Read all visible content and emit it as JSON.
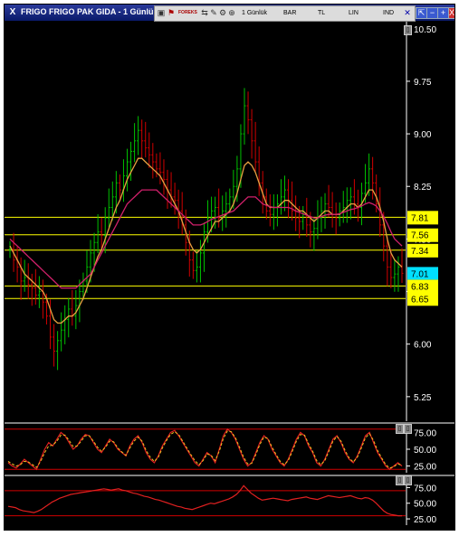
{
  "window": {
    "title": "FRIGO FRIGO PAK GIDA - 1 Günlük (.1d)",
    "close_glyph": "X"
  },
  "toolbar": {
    "forex_label": "FOREKS",
    "period_label": "1 Günlük",
    "chart_type_label": "BAR",
    "currency_label": "TL",
    "scale_label": "LIN",
    "indicator_label": "IND"
  },
  "window_buttons": [
    "⇱",
    "−",
    "+",
    "X"
  ],
  "colors": {
    "background": "#000000",
    "accent": "#ffff00",
    "price_tag": "#00e0ff",
    "ma_fast": "#e8a040",
    "ma_slow": "#d0206a",
    "bull_candle": "#00c000",
    "bear_candle": "#d00000"
  },
  "chart_data": [
    {
      "type": "line",
      "title": "",
      "ylim": [
        4.9,
        10.6
      ],
      "yticks": [
        "10.50",
        "9.75",
        "9.00",
        "8.25",
        "7.50",
        "6.75",
        "6.00",
        "5.25"
      ],
      "yaxis_position": "right",
      "grid": false,
      "last_price": "7.01",
      "levels": [
        {
          "label": "7.81",
          "value": 7.81
        },
        {
          "label": "7.56",
          "value": 7.56
        },
        {
          "label": "7.34",
          "value": 7.34
        },
        {
          "label": "6.83",
          "value": 6.83
        },
        {
          "label": "6.65",
          "value": 6.65
        }
      ],
      "close": [
        7.35,
        7.2,
        7.1,
        6.9,
        6.95,
        6.85,
        6.8,
        6.7,
        6.75,
        6.6,
        6.4,
        6.1,
        5.9,
        6.05,
        6.2,
        6.35,
        6.5,
        6.4,
        6.55,
        6.75,
        6.9,
        7.1,
        7.3,
        7.45,
        7.6,
        7.55,
        7.8,
        7.95,
        8.1,
        8.3,
        8.2,
        8.4,
        8.6,
        8.75,
        8.9,
        9.05,
        8.9,
        8.8,
        8.7,
        8.6,
        8.5,
        8.45,
        8.35,
        8.2,
        8.1,
        8.05,
        7.9,
        7.7,
        7.45,
        7.2,
        7.05,
        7.1,
        7.3,
        7.6,
        7.8,
        7.9,
        7.95,
        7.8,
        7.9,
        8.0,
        8.1,
        8.25,
        8.5,
        9.0,
        9.4,
        9.2,
        8.9,
        8.6,
        8.3,
        8.1,
        7.9,
        7.85,
        7.95,
        8.0,
        8.1,
        8.2,
        8.05,
        7.9,
        7.8,
        7.75,
        7.85,
        7.7,
        7.6,
        7.65,
        7.8,
        7.9,
        8.0,
        7.95,
        7.85,
        7.8,
        7.9,
        7.95,
        8.05,
        8.1,
        8.0,
        7.95,
        8.15,
        8.3,
        8.5,
        8.3,
        8.0,
        7.7,
        7.4,
        7.1,
        6.95,
        7.0,
        7.1,
        7.01
      ],
      "ma_fast": [
        7.4,
        7.3,
        7.2,
        7.1,
        7.0,
        6.95,
        6.9,
        6.85,
        6.8,
        6.75,
        6.65,
        6.5,
        6.35,
        6.3,
        6.3,
        6.35,
        6.4,
        6.4,
        6.45,
        6.55,
        6.65,
        6.8,
        6.95,
        7.1,
        7.25,
        7.35,
        7.5,
        7.65,
        7.8,
        7.95,
        8.05,
        8.2,
        8.35,
        8.45,
        8.55,
        8.65,
        8.65,
        8.6,
        8.55,
        8.5,
        8.45,
        8.4,
        8.3,
        8.2,
        8.1,
        8.0,
        7.9,
        7.75,
        7.6,
        7.45,
        7.35,
        7.3,
        7.35,
        7.45,
        7.55,
        7.65,
        7.75,
        7.75,
        7.8,
        7.85,
        7.9,
        8.0,
        8.15,
        8.35,
        8.55,
        8.6,
        8.55,
        8.45,
        8.3,
        8.15,
        8.0,
        7.95,
        7.95,
        7.95,
        8.0,
        8.05,
        8.05,
        8.0,
        7.95,
        7.9,
        7.9,
        7.85,
        7.8,
        7.75,
        7.8,
        7.85,
        7.9,
        7.9,
        7.85,
        7.85,
        7.85,
        7.9,
        7.95,
        8.0,
        8.0,
        7.95,
        8.0,
        8.1,
        8.2,
        8.2,
        8.1,
        7.95,
        7.75,
        7.5,
        7.3,
        7.2,
        7.15,
        7.1
      ],
      "ma_slow": [
        7.5,
        7.45,
        7.4,
        7.35,
        7.3,
        7.25,
        7.2,
        7.15,
        7.1,
        7.05,
        7.0,
        6.95,
        6.9,
        6.85,
        6.8,
        6.8,
        6.8,
        6.8,
        6.8,
        6.85,
        6.9,
        6.95,
        7.0,
        7.1,
        7.2,
        7.3,
        7.4,
        7.5,
        7.6,
        7.7,
        7.8,
        7.9,
        8.0,
        8.05,
        8.1,
        8.15,
        8.2,
        8.2,
        8.2,
        8.2,
        8.2,
        8.15,
        8.1,
        8.05,
        8.0,
        7.95,
        7.9,
        7.85,
        7.8,
        7.75,
        7.7,
        7.7,
        7.7,
        7.72,
        7.75,
        7.78,
        7.8,
        7.82,
        7.84,
        7.86,
        7.88,
        7.9,
        7.95,
        8.0,
        8.05,
        8.1,
        8.1,
        8.1,
        8.05,
        8.0,
        7.98,
        7.96,
        7.95,
        7.95,
        7.95,
        7.95,
        7.95,
        7.93,
        7.9,
        7.88,
        7.86,
        7.84,
        7.82,
        7.8,
        7.8,
        7.82,
        7.84,
        7.85,
        7.85,
        7.85,
        7.86,
        7.88,
        7.9,
        7.92,
        7.93,
        7.95,
        7.97,
        8.0,
        8.02,
        8.0,
        7.97,
        7.9,
        7.82,
        7.72,
        7.6,
        7.5,
        7.45,
        7.4
      ]
    },
    {
      "type": "line",
      "title": "",
      "ylim": [
        15,
        85
      ],
      "yticks": [
        "75.00",
        "50.00",
        "25.00"
      ],
      "extra_ticks": [
        "75.00",
        "50.00",
        "25.00"
      ],
      "bands": [
        80,
        20
      ],
      "values": [
        30,
        25,
        22,
        28,
        35,
        30,
        25,
        20,
        35,
        50,
        60,
        55,
        65,
        75,
        70,
        60,
        50,
        55,
        65,
        72,
        70,
        60,
        50,
        45,
        55,
        65,
        60,
        50,
        45,
        40,
        55,
        65,
        70,
        60,
        45,
        35,
        30,
        40,
        55,
        65,
        75,
        78,
        70,
        60,
        50,
        40,
        30,
        25,
        35,
        45,
        40,
        30,
        50,
        70,
        80,
        75,
        65,
        50,
        35,
        25,
        30,
        45,
        60,
        70,
        65,
        50,
        40,
        30,
        25,
        35,
        50,
        65,
        75,
        70,
        55,
        45,
        30,
        25,
        35,
        50,
        65,
        70,
        60,
        45,
        35,
        30,
        40,
        55,
        70,
        75,
        60,
        45,
        35,
        25,
        20,
        25,
        30,
        25
      ],
      "signal": [
        32,
        28,
        25,
        27,
        32,
        31,
        27,
        23,
        32,
        45,
        55,
        56,
        62,
        71,
        71,
        63,
        54,
        55,
        62,
        70,
        70,
        62,
        53,
        47,
        53,
        62,
        61,
        52,
        46,
        41,
        52,
        62,
        68,
        62,
        48,
        38,
        32,
        38,
        52,
        63,
        72,
        76,
        72,
        62,
        52,
        42,
        33,
        27,
        33,
        43,
        41,
        33,
        47,
        66,
        77,
        76,
        67,
        53,
        38,
        28,
        29,
        42,
        57,
        68,
        66,
        53,
        42,
        32,
        27,
        33,
        47,
        62,
        72,
        71,
        58,
        47,
        33,
        27,
        33,
        47,
        62,
        69,
        62,
        48,
        37,
        31,
        38,
        52,
        67,
        73,
        63,
        48,
        37,
        27,
        22,
        24,
        28,
        26
      ]
    },
    {
      "type": "line",
      "title": "",
      "ylim": [
        15,
        90
      ],
      "yticks": [
        "75.00",
        "50.00",
        "25.00"
      ],
      "bands": [
        70,
        30
      ],
      "values": [
        45,
        44,
        43,
        40,
        38,
        37,
        36,
        35,
        37,
        40,
        44,
        48,
        52,
        55,
        58,
        60,
        62,
        64,
        65,
        66,
        67,
        68,
        69,
        70,
        71,
        72,
        73,
        72,
        71,
        72,
        73,
        71,
        70,
        68,
        66,
        65,
        63,
        61,
        60,
        58,
        56,
        55,
        53,
        51,
        49,
        47,
        45,
        44,
        42,
        41,
        40,
        42,
        44,
        46,
        48,
        50,
        49,
        51,
        53,
        55,
        57,
        60,
        64,
        70,
        78,
        72,
        66,
        62,
        58,
        55,
        56,
        57,
        58,
        57,
        56,
        55,
        54,
        56,
        57,
        58,
        59,
        60,
        58,
        57,
        56,
        58,
        60,
        62,
        61,
        60,
        59,
        60,
        61,
        62,
        60,
        58,
        57,
        59,
        58,
        55,
        50,
        44,
        38,
        34,
        32,
        31,
        30,
        30
      ]
    }
  ]
}
